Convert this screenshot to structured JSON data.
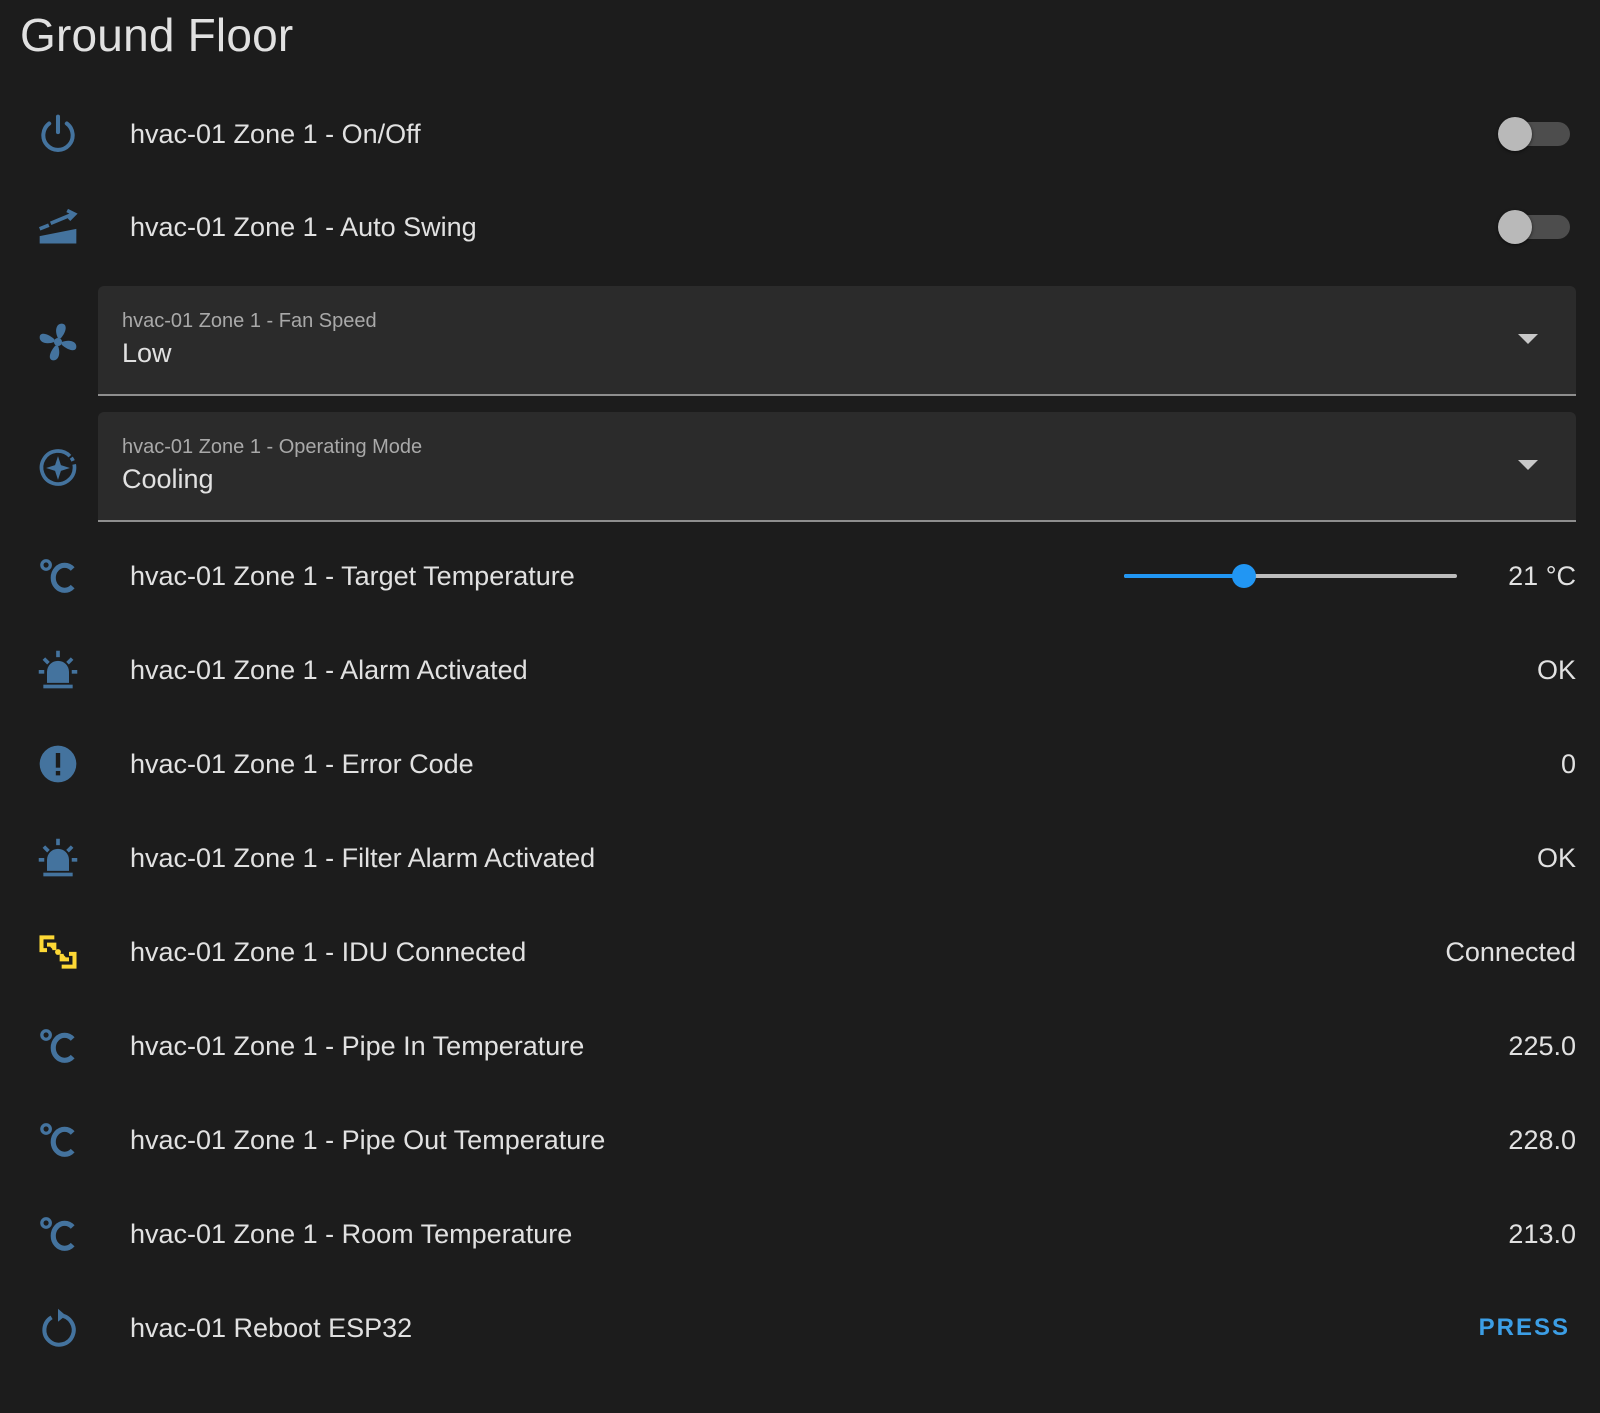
{
  "card": {
    "title": "Ground Floor"
  },
  "colors": {
    "icon": "#44739e",
    "connected_icon": "#fdd835",
    "accent": "#2196f3"
  },
  "rows": {
    "on_off": {
      "icon": "power-icon",
      "label": "hvac-01 Zone 1 - On/Off",
      "state": "off"
    },
    "auto_swing": {
      "icon": "swing-icon",
      "label": "hvac-01 Zone 1 - Auto Swing",
      "state": "off"
    },
    "fan_speed": {
      "icon": "fan-icon",
      "label": "hvac-01 Zone 1 - Fan Speed",
      "value": "Low"
    },
    "operating_mode": {
      "icon": "mode-icon",
      "label": "hvac-01 Zone 1 - Operating Mode",
      "value": "Cooling"
    },
    "target_temperature": {
      "icon": "temperature-celsius-icon",
      "label": "hvac-01 Zone 1 - Target Temperature",
      "value": "21 °C",
      "slider_fraction": 0.36
    },
    "alarm_activated": {
      "icon": "alarm-light-icon",
      "label": "hvac-01 Zone 1 - Alarm Activated",
      "value": "OK"
    },
    "error_code": {
      "icon": "alert-circle-icon",
      "label": "hvac-01 Zone 1 - Error Code",
      "value": "0"
    },
    "filter_alarm": {
      "icon": "alarm-light-icon",
      "label": "hvac-01 Zone 1 - Filter Alarm Activated",
      "value": "OK"
    },
    "idu_connected": {
      "icon": "connection-icon",
      "label": "hvac-01 Zone 1 - IDU Connected",
      "value": "Connected"
    },
    "pipe_in": {
      "icon": "temperature-celsius-icon",
      "label": "hvac-01 Zone 1 - Pipe In Temperature",
      "value": "225.0"
    },
    "pipe_out": {
      "icon": "temperature-celsius-icon",
      "label": "hvac-01 Zone 1 - Pipe Out Temperature",
      "value": "228.0"
    },
    "room_temp": {
      "icon": "temperature-celsius-icon",
      "label": "hvac-01 Zone 1 - Room Temperature",
      "value": "213.0"
    },
    "reboot": {
      "icon": "restart-icon",
      "label": "hvac-01 Reboot ESP32",
      "button_label": "PRESS"
    }
  }
}
